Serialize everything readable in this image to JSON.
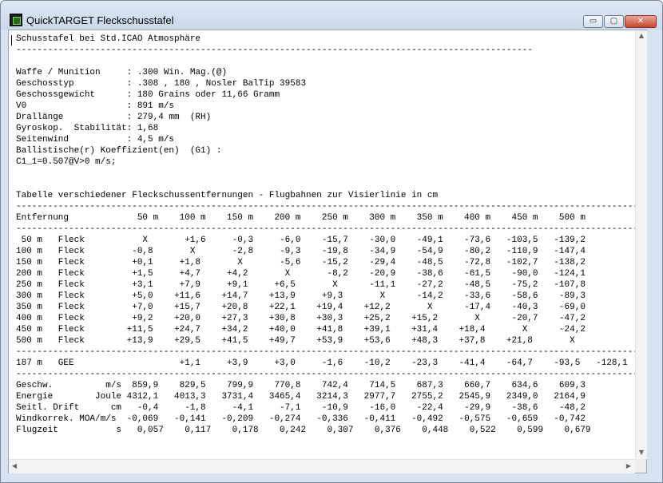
{
  "window": {
    "title": "QuickTARGET Fleckschusstafel",
    "controls": {
      "minimize": "▭",
      "maximize": "▢",
      "close": "✕"
    }
  },
  "icons": {
    "app": "app-icon",
    "minimize": "minimize-icon",
    "maximize": "maximize-icon",
    "close": "close-icon"
  },
  "scrollbars": {
    "up": "▲",
    "down": "▼",
    "left": "◀",
    "right": "▶"
  },
  "lines": [
    "Schusstafel bei Std.ICAO Atmosphäre",
    "--------------------------------------------------------------------------------------------------",
    "",
    "Waffe / Munition     : .300 Win. Mag.(@)",
    "Geschosstyp          : .308 , 180 , Nosler BalTip 39583",
    "Geschossgewicht      : 180 Grains oder 11,66 Gramm",
    "V0                   : 891 m/s",
    "Drallänge            : 279,4 mm  (RH)",
    "Gyroskop.  Stabilität: 1,68",
    "Seitenwind           : 4,5 m/s",
    "Ballistische(r) Koeffizient(en)  (G1) :",
    "C1_1=0.507@V>0 m/s;",
    "",
    "",
    "Tabelle verschiedener Fleckschussentfernungen - Flugbahnen zur Visierlinie in cm",
    "-------------------------------------------------------------------------------------------------------------------------",
    "Entfernung             50 m    100 m    150 m    200 m    250 m    300 m    350 m    400 m    450 m    500 m",
    "-------------------------------------------------------------------------------------------------------------------------",
    " 50 m   Fleck           X       +1,6     -0,3     -6,0    -15,7    -30,0    -49,1    -73,6   -103,5   -139,2",
    "100 m   Fleck         -0,8       X       -2,8     -9,3    -19,8    -34,9    -54,9    -80,2   -110,9   -147,4",
    "150 m   Fleck         +0,1     +1,8       X       -5,6    -15,2    -29,4    -48,5    -72,8   -102,7   -138,2",
    "200 m   Fleck         +1,5     +4,7     +4,2       X       -8,2    -20,9    -38,6    -61,5    -90,0   -124,1",
    "250 m   Fleck         +3,1     +7,9     +9,1     +6,5       X      -11,1    -27,2    -48,5    -75,2   -107,8",
    "300 m   Fleck         +5,0    +11,6    +14,7    +13,9     +9,3       X      -14,2    -33,6    -58,6    -89,3",
    "350 m   Fleck         +7,0    +15,7    +20,8    +22,1    +19,4    +12,2       X      -17,4    -40,3    -69,0",
    "400 m   Fleck         +9,2    +20,0    +27,3    +30,8    +30,3    +25,2    +15,2       X      -20,7    -47,2",
    "450 m   Fleck        +11,5    +24,7    +34,2    +40,0    +41,8    +39,1    +31,4    +18,4       X      -24,2",
    "500 m   Fleck        +13,9    +29,5    +41,5    +49,7    +53,9    +53,6    +48,3    +37,8    +21,8       X",
    "-------------------------------------------------------------------------------------------------------------------------",
    "187 m   GEE                    +1,1     +3,9     +3,0     -1,6    -10,2    -23,3    -41,4    -64,7    -93,5   -128,1",
    "-------------------------------------------------------------------------------------------------------------------------",
    "Geschw.          m/s  859,9    829,5    799,9    770,8    742,4    714,5    687,3    660,7    634,6    609,3",
    "Energie        Joule 4312,1   4013,3   3731,4   3465,4   3214,3   2977,7   2755,2   2545,9   2349,0   2164,9",
    "Seitl. Drift      cm   -0,4     -1,8     -4,1     -7,1    -10,9    -16,0    -22,4    -29,9    -38,6    -48,2",
    "Windkorrek. MOA/m/s  -0,069   -0,141   -0,209   -0,274   -0,336   -0,411   -0,492   -0,575   -0,659   -0,742",
    "Flugzeit           s   0,057    0,117    0,178    0,242    0,307    0,376    0,448    0,522    0,599    0,679"
  ]
}
